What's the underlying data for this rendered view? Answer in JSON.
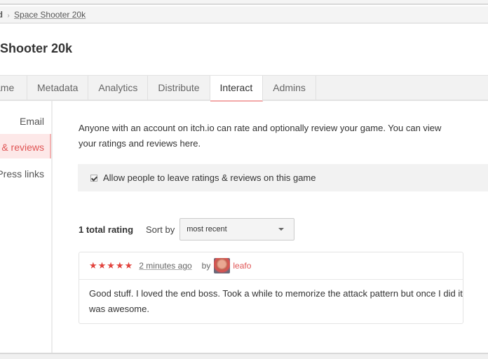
{
  "breadcrumb": {
    "first": "rd",
    "separator": "›",
    "current": "Space Shooter 20k"
  },
  "page_title": "Shooter 20k",
  "tabs": [
    {
      "label": "ame",
      "active": false
    },
    {
      "label": "Metadata",
      "active": false
    },
    {
      "label": "Analytics",
      "active": false
    },
    {
      "label": "Distribute",
      "active": false
    },
    {
      "label": "Interact",
      "active": true
    },
    {
      "label": "Admins",
      "active": false
    }
  ],
  "sidebar": {
    "items": [
      {
        "label": "Email",
        "active": false
      },
      {
        "label": "& reviews",
        "active": true
      },
      {
        "label": "Press links",
        "active": false
      }
    ]
  },
  "intro_text": "Anyone with an account on itch.io can rate and optionally review your game. You can view your ratings and reviews here.",
  "allow_reviews": {
    "label": "Allow people to leave ratings & reviews on this game",
    "checked": true
  },
  "ratings": {
    "total_label": "1 total rating",
    "sort_label": "Sort by",
    "sort_value": "most recent"
  },
  "reviews": [
    {
      "stars": "★★★★★",
      "rating": 5,
      "time": "2 minutes ago",
      "by_label": "by",
      "user": "leafo",
      "body": "Good stuff. I loved the end boss. Took a while to memorize the attack pattern but once I did it was awesome."
    }
  ],
  "colors": {
    "accent": "#e05555",
    "star": "#e2433d",
    "active_tab_underline": "#f3a9a9",
    "sidebar_active_bg": "#fde8e8"
  }
}
